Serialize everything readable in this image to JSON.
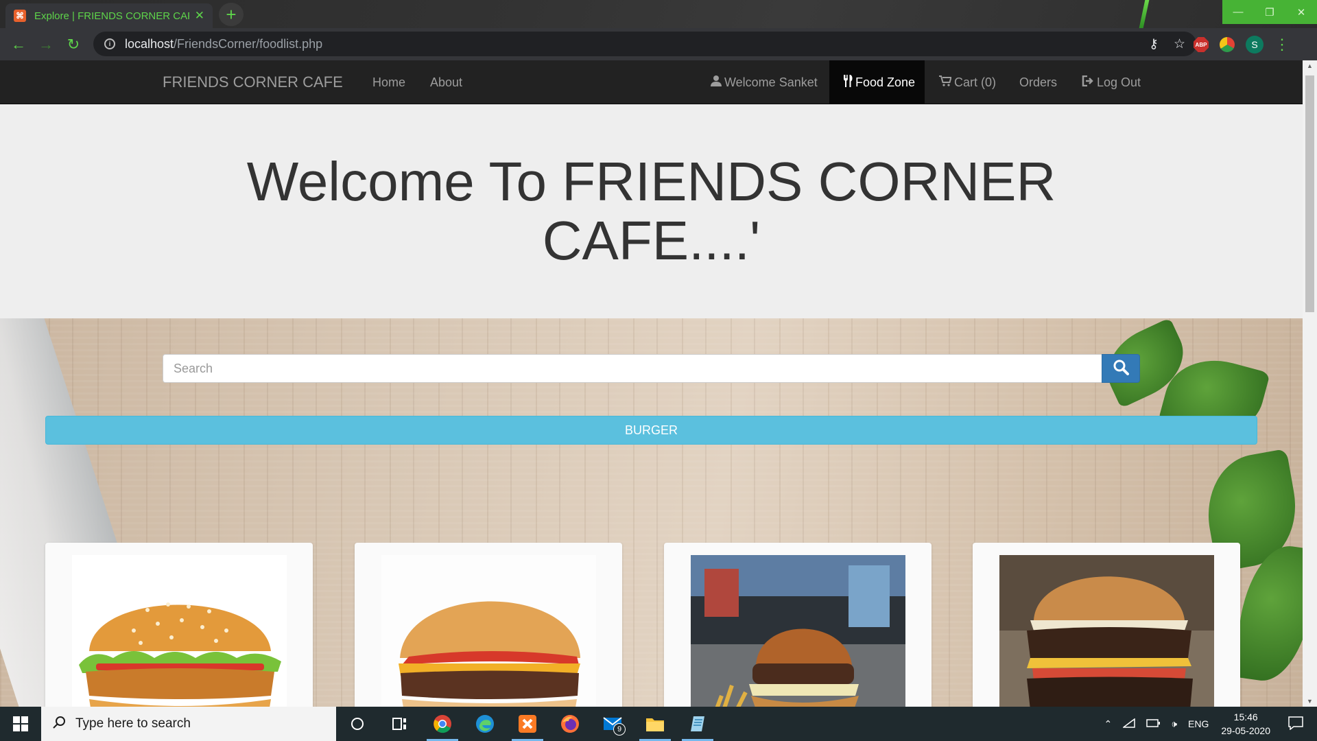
{
  "browser": {
    "tab_title": "Explore | FRIENDS CORNER CAFE",
    "tab_favicon": "xampp-icon",
    "url_host": "localhost",
    "url_path": "/FriendsCorner/foodlist.php",
    "avatar_letter": "S",
    "abp_label": "ABP",
    "accent_color": "#5ed44a"
  },
  "navbar": {
    "brand": "FRIENDS CORNER CAFE",
    "left_links": [
      "Home",
      "About"
    ],
    "welcome": "Welcome Sanket",
    "food_zone": "Food Zone",
    "cart": "Cart (0)",
    "orders": "Orders",
    "logout": "Log Out"
  },
  "jumbotron": {
    "heading": "Welcome To FRIENDS CORNER CAFE....'"
  },
  "search": {
    "placeholder": "Search"
  },
  "category": {
    "title": "BURGER",
    "color": "#5bc0de"
  },
  "food_items": [
    {
      "image": "veg-burger-image"
    },
    {
      "image": "cheeseburger-image"
    },
    {
      "image": "burger-with-fries-image"
    },
    {
      "image": "double-burger-image"
    }
  ],
  "taskbar": {
    "search_placeholder": "Type here to search",
    "mail_badge": "9",
    "language": "ENG",
    "time": "15:46",
    "date": "29-05-2020"
  }
}
